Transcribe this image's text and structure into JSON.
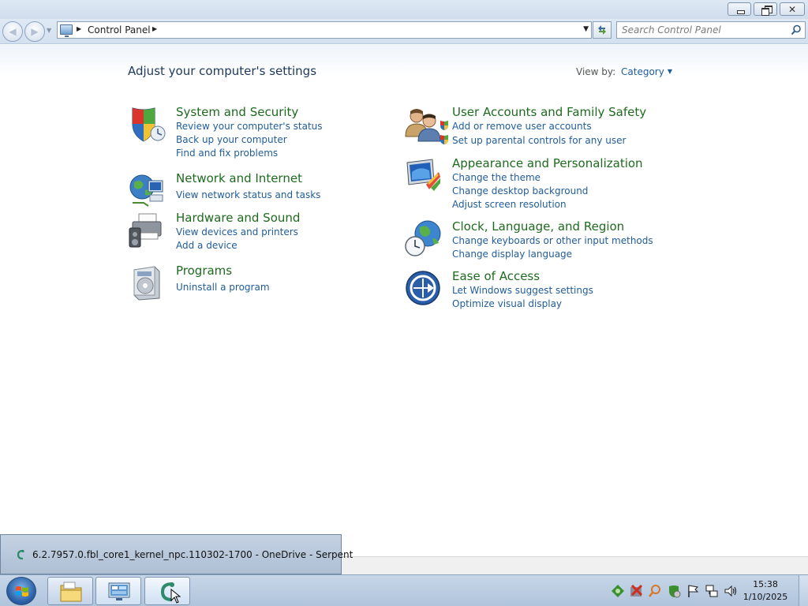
{
  "address": {
    "path": "Control Panel",
    "refresh_icon": "refresh-arrows-icon"
  },
  "search": {
    "placeholder": "Search Control Panel"
  },
  "header": {
    "title": "Adjust your computer's settings",
    "view_by_label": "View by:",
    "view_by_value": "Category"
  },
  "categories": [
    {
      "title": "System and Security",
      "icon": "shield-icon",
      "links": [
        "Review your computer's status",
        "Back up your computer",
        "Find and fix problems"
      ]
    },
    {
      "title": "Network and Internet",
      "icon": "network-globe-icon",
      "links": [
        "View network status and tasks"
      ]
    },
    {
      "title": "Hardware and Sound",
      "icon": "printer-speaker-icon",
      "links": [
        "View devices and printers",
        "Add a device"
      ]
    },
    {
      "title": "Programs",
      "icon": "programs-box-icon",
      "links": [
        "Uninstall a program"
      ]
    },
    {
      "title": "User Accounts and Family Safety",
      "icon": "users-icon",
      "links": [
        "Add or remove user accounts",
        "Set up parental controls for any user"
      ]
    },
    {
      "title": "Appearance and Personalization",
      "icon": "monitor-palette-icon",
      "links": [
        "Change the theme",
        "Change desktop background",
        "Adjust screen resolution"
      ]
    },
    {
      "title": "Clock, Language, and Region",
      "icon": "clock-globe-icon",
      "links": [
        "Change keyboards or other input methods",
        "Change display language"
      ]
    },
    {
      "title": "Ease of Access",
      "icon": "ease-of-access-icon",
      "links": [
        "Let Windows suggest settings",
        "Optimize visual display"
      ]
    }
  ],
  "taskbar": {
    "tooltip": "6.2.7957.0.fbl_core1_kernel_npc.110302-1700 - OneDrive - Serpent",
    "buttons": [
      "explorer-folder-icon",
      "control-panel-icon",
      "serpent-app-icon"
    ],
    "tray_icons": [
      "network-tray-icon",
      "error-tray-icon",
      "search-tray-icon",
      "security-tray-icon",
      "flag-tray-icon",
      "network-adapter-tray-icon",
      "volume-tray-icon"
    ],
    "time": "15:38",
    "date": "1/10/2025"
  },
  "colors": {
    "link": "#1f5c99",
    "category_title": "#1e6a1e",
    "page_title": "#1e395b"
  }
}
